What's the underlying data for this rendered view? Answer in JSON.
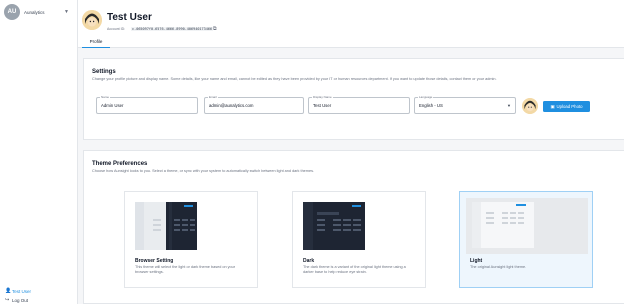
{
  "sidebar": {
    "org": {
      "initials": "AU",
      "name": "Aunalytics"
    },
    "items": [
      {
        "label": "Test User",
        "icon": "person-icon"
      },
      {
        "label": "Log Out",
        "icon": "logout-icon"
      }
    ]
  },
  "header": {
    "title": "Test User",
    "account_id_label": "Account ID:",
    "account_id": "c-065097f0-6576-4666-8990-406940173466",
    "tabs": [
      {
        "label": "Profile",
        "active": true
      }
    ]
  },
  "settings": {
    "title": "Settings",
    "description": "Change your profile picture and display name. Some details, like your name and email, cannot be edited as they have been provided by your IT or human resources department. If you want to update those details, contact them or your admin.",
    "fields": {
      "name": {
        "label": "Name",
        "value": "Admin User"
      },
      "email": {
        "label": "Email",
        "value": "admin@aunalytics.com"
      },
      "display_name": {
        "label": "Display Name",
        "value": "Test User"
      },
      "language": {
        "label": "Language",
        "value": "English - US"
      }
    },
    "upload_label": "Upload Photo"
  },
  "theme": {
    "title": "Theme Preferences",
    "description": "Choose how Aunsight looks to you. Select a theme, or sync with your system to automatically switch between light and dark themes.",
    "options": [
      {
        "title": "Browser Setting",
        "desc": "This theme will select the light or dark theme based on your browser settings."
      },
      {
        "title": "Dark",
        "desc": "The dark theme is a variant of the original light theme using a darker base to help reduce eye strain."
      },
      {
        "title": "Light",
        "desc": "The original Aunsight light theme.",
        "selected": true
      }
    ]
  },
  "colors": {
    "accent": "#1f8fe0",
    "selected_bg": "#eef6fd"
  }
}
